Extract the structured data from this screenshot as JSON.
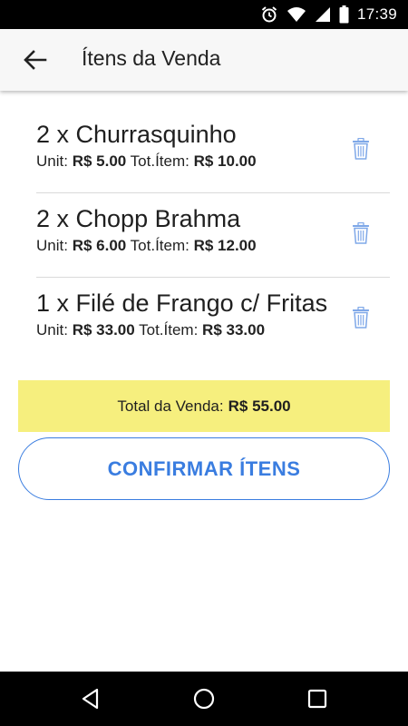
{
  "status_bar": {
    "time": "17:39"
  },
  "app_bar": {
    "title": "Ítens da Venda"
  },
  "items": [
    {
      "name": "2 x Churrasquinho",
      "unit_label": "Unit:",
      "unit_value": "R$ 5.00",
      "total_label": "Tot.Ítem:",
      "total_value": "R$ 10.00"
    },
    {
      "name": "2 x Chopp Brahma",
      "unit_label": "Unit:",
      "unit_value": "R$ 6.00",
      "total_label": "Tot.Ítem:",
      "total_value": "R$ 12.00"
    },
    {
      "name": "1 x Filé de Frango c/ Fritas",
      "unit_label": "Unit:",
      "unit_value": "R$ 33.00",
      "total_label": "Tot.Ítem:",
      "total_value": "R$ 33.00"
    }
  ],
  "summary": {
    "label": "Total da Venda:",
    "value": "R$ 55.00"
  },
  "confirm_button": {
    "label": "CONFIRMAR ÍTENS"
  },
  "colors": {
    "accent": "#3a7de0",
    "total_bg": "#f6ef7e",
    "trash_icon": "#7fa8e8"
  },
  "icons": [
    "alarm-icon",
    "wifi-icon",
    "cellular-signal-icon",
    "battery-icon",
    "arrow-back-icon",
    "trash-icon",
    "nav-back-icon",
    "nav-home-icon",
    "nav-recents-icon"
  ]
}
